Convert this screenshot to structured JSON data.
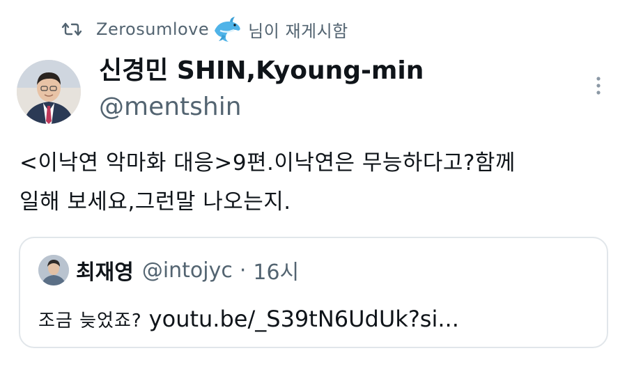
{
  "retweet": {
    "icon": "retweet-icon",
    "user": "Zerosumlove",
    "badge_icon": "dolphin-icon",
    "suffix": "님이 재게시함"
  },
  "author": {
    "name": "신경민 SHIN,Kyoung-min",
    "handle": "@mentshin",
    "avatar_icon": "avatar"
  },
  "tweet": {
    "line1": "<이낙연 악마화 대응>9편.이낙연은 무능하다고?함께",
    "line2": "일해 보세요,그런말 나오는지."
  },
  "quote": {
    "name": "최재영",
    "handle": "@intojyc",
    "dot": "·",
    "time": "16시",
    "text_korean": "조금 늦었죠?",
    "text_link": "youtu.be/_S39tN6UdUk?si..."
  },
  "colors": {
    "text": "#0f1419",
    "secondary": "#536471",
    "border": "#e1e6ea",
    "dolphin": "#4fb3e8"
  }
}
